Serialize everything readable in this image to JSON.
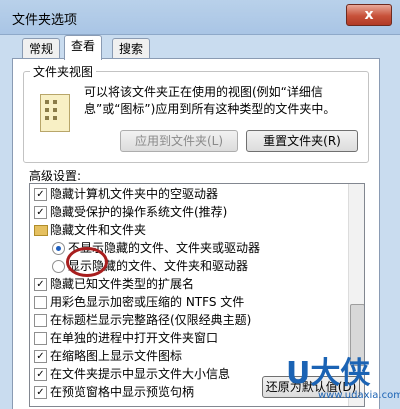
{
  "window": {
    "title": "文件夹选项",
    "close_glyph": "x"
  },
  "tabs": [
    "常规",
    "查看",
    "搜索"
  ],
  "folder_views": {
    "legend": "文件夹视图",
    "description": "可以将该文件夹正在使用的视图(例如“详细信息”或“图标”)应用到所有这种类型的文件夹中。",
    "apply_button": "应用到文件夹(L)",
    "reset_button": "重置文件夹(R)"
  },
  "advanced": {
    "label": "高级设置:",
    "items": [
      {
        "type": "checkbox",
        "checked": true,
        "label": "隐藏计算机文件夹中的空驱动器"
      },
      {
        "type": "checkbox",
        "checked": true,
        "label": "隐藏受保护的操作系统文件(推荐)"
      },
      {
        "type": "folder",
        "label": "隐藏文件和文件夹"
      },
      {
        "type": "radio",
        "checked": true,
        "label": "不显示隐藏的文件、文件夹或驱动器"
      },
      {
        "type": "radio",
        "checked": false,
        "label": "显示隐藏的文件、文件夹和驱动器"
      },
      {
        "type": "checkbox",
        "checked": true,
        "label": "隐藏已知文件类型的扩展名"
      },
      {
        "type": "checkbox",
        "checked": false,
        "label": "用彩色显示加密或压缩的 NTFS 文件"
      },
      {
        "type": "checkbox",
        "checked": false,
        "label": "在标题栏显示完整路径(仅限经典主题)"
      },
      {
        "type": "checkbox",
        "checked": false,
        "label": "在单独的进程中打开文件夹窗口"
      },
      {
        "type": "checkbox",
        "checked": true,
        "label": "在缩略图上显示文件图标"
      },
      {
        "type": "checkbox",
        "checked": true,
        "label": "在文件夹提示中显示文件大小信息"
      },
      {
        "type": "checkbox",
        "checked": true,
        "label": "在预览窗格中显示预览句柄"
      }
    ]
  },
  "restore_button": "还原为默认值(D)",
  "watermark": {
    "brand": "U大侠",
    "url": "www.udaxia.com"
  },
  "colors": {
    "highlight_oval": "#a81e1e",
    "watermark": "#1b63b4"
  }
}
